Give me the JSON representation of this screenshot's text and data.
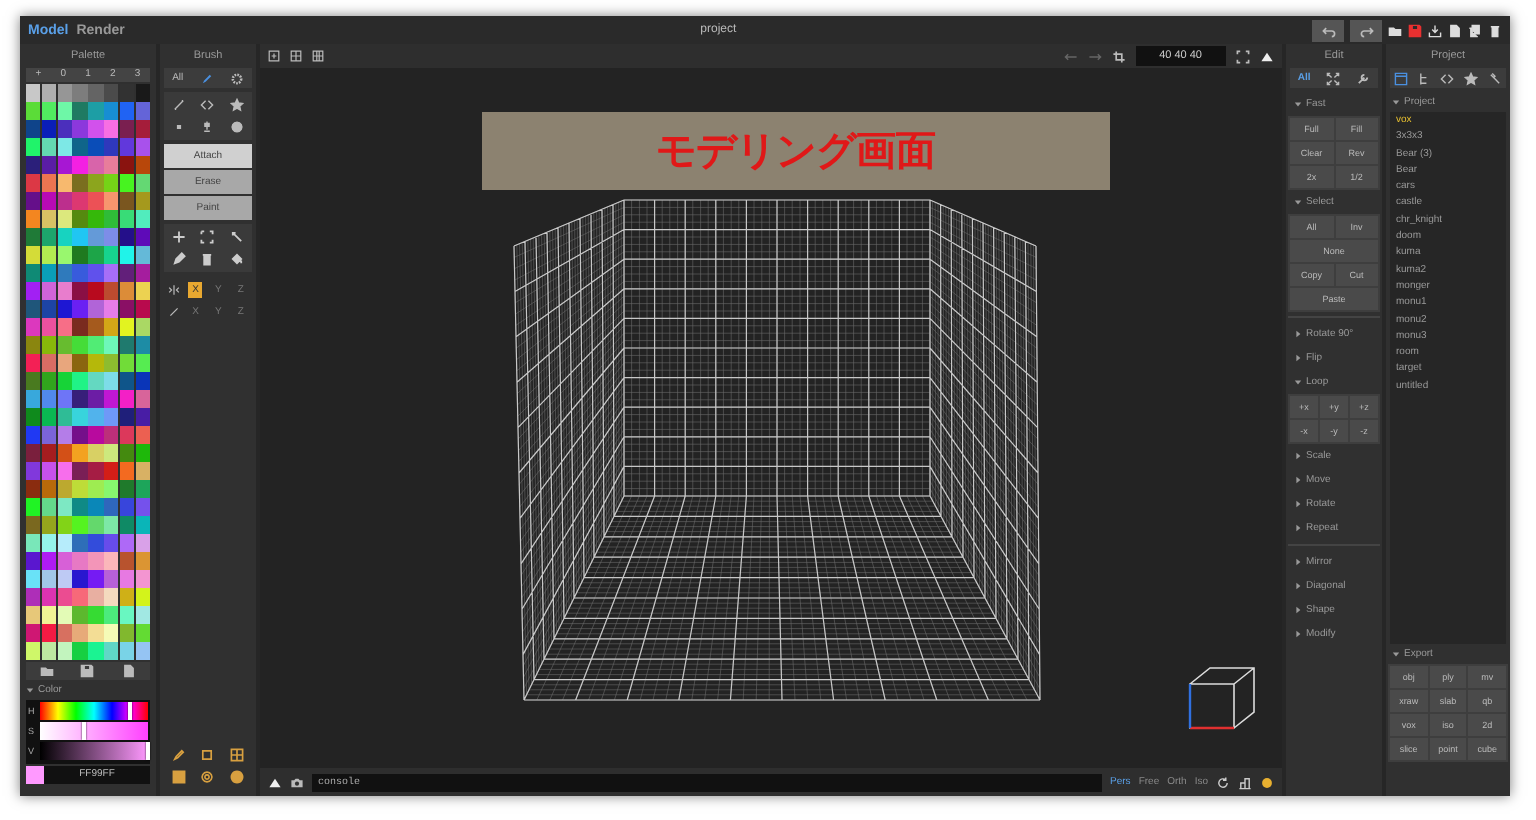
{
  "menu_tabs": [
    {
      "label": "Model",
      "selected": true
    },
    {
      "label": "Render",
      "selected": false
    }
  ],
  "title": "project",
  "palette": {
    "title": "Palette",
    "pages": [
      "+",
      "0",
      "1",
      "2",
      "3"
    ]
  },
  "color": {
    "title": "Color",
    "channels": [
      {
        "label": "H",
        "level": 0.83
      },
      {
        "label": "S",
        "level": 0.4
      },
      {
        "label": "V",
        "level": 1.0
      }
    ],
    "hex": "FF99FF"
  },
  "brush": {
    "title": "Brush",
    "tab": "All",
    "modes": [
      {
        "label": "Attach",
        "selected": true
      },
      {
        "label": "Erase",
        "selected": false
      },
      {
        "label": "Paint",
        "selected": false
      }
    ],
    "mirror": [
      {
        "label": "X",
        "selected": true
      },
      {
        "label": "Y",
        "selected": false
      },
      {
        "label": "Z",
        "selected": false
      }
    ],
    "axis": [
      {
        "label": "X",
        "selected": false
      },
      {
        "label": "Y",
        "selected": false
      },
      {
        "label": "Z",
        "selected": false
      }
    ]
  },
  "viewport": {
    "size": "40 40 40",
    "banner": "モデリング画面",
    "console": {
      "placeholder": "console"
    },
    "views": [
      {
        "label": "Pers",
        "selected": true
      },
      {
        "label": "Free",
        "selected": false
      },
      {
        "label": "Orth",
        "selected": false
      },
      {
        "label": "Iso",
        "selected": false
      }
    ]
  },
  "edit": {
    "title": "Edit",
    "tab": "All",
    "groups": [
      {
        "sections": [
          {
            "label": "Fast",
            "expanded": true,
            "kind": "pairs",
            "buttons": [
              {
                "label": "Full",
                "wide": false
              },
              {
                "label": "Fill",
                "wide": false
              },
              {
                "label": "Clear",
                "wide": false
              },
              {
                "label": "Rev",
                "wide": false
              },
              {
                "label": "2x",
                "wide": false
              },
              {
                "label": "1/2",
                "wide": false
              }
            ]
          },
          {
            "label": "Select",
            "expanded": true,
            "kind": "pairs",
            "buttons": [
              {
                "label": "All",
                "wide": false
              },
              {
                "label": "Inv",
                "wide": false
              },
              {
                "label": "None",
                "wide": true
              },
              {
                "label": "Copy",
                "wide": false
              },
              {
                "label": "Cut",
                "wide": false
              },
              {
                "label": "Paste",
                "wide": true
              }
            ]
          }
        ]
      },
      {
        "sections": [
          {
            "label": "Rotate 90°",
            "expanded": false
          },
          {
            "label": "Flip",
            "expanded": false
          },
          {
            "label": "Loop",
            "expanded": true,
            "kind": "triples",
            "buttons": [
              {
                "label": "+x",
                "wide": false
              },
              {
                "label": "+y",
                "wide": false
              },
              {
                "label": "+z",
                "wide": false
              },
              {
                "label": "-x",
                "wide": false
              },
              {
                "label": "-y",
                "wide": false
              },
              {
                "label": "-z",
                "wide": false
              }
            ]
          },
          {
            "label": "Scale",
            "expanded": false
          },
          {
            "label": "Move",
            "expanded": false
          },
          {
            "label": "Rotate",
            "expanded": false
          },
          {
            "label": "Repeat",
            "expanded": false
          }
        ]
      },
      {
        "sections": [
          {
            "label": "Mirror",
            "expanded": false
          },
          {
            "label": "Diagonal",
            "expanded": false
          },
          {
            "label": "Shape",
            "expanded": false
          },
          {
            "label": "Modify",
            "expanded": false
          }
        ]
      }
    ]
  },
  "project": {
    "title": "Project",
    "list_title": "Project",
    "files": [
      {
        "label": "vox",
        "selected": true
      },
      {
        "label": "3x3x3",
        "selected": false
      },
      {
        "label": "Bear (3)",
        "selected": false
      },
      {
        "label": "Bear",
        "selected": false
      },
      {
        "label": "cars",
        "selected": false
      },
      {
        "label": "castle",
        "selected": false
      },
      {
        "label": "chr_knight",
        "selected": false
      },
      {
        "label": "doom",
        "selected": false
      },
      {
        "label": "kuma",
        "selected": false
      },
      {
        "label": "kuma2",
        "selected": false
      },
      {
        "label": "monger",
        "selected": false
      },
      {
        "label": "monu1",
        "selected": false
      },
      {
        "label": "monu2",
        "selected": false
      },
      {
        "label": "monu3",
        "selected": false
      },
      {
        "label": "room",
        "selected": false
      },
      {
        "label": "target",
        "selected": false
      },
      {
        "label": "untitled",
        "selected": false
      }
    ],
    "export_title": "Export",
    "export": [
      "obj",
      "ply",
      "mv",
      "xraw",
      "slab",
      "qb",
      "vox",
      "iso",
      "2d",
      "slice",
      "point",
      "cube"
    ]
  }
}
